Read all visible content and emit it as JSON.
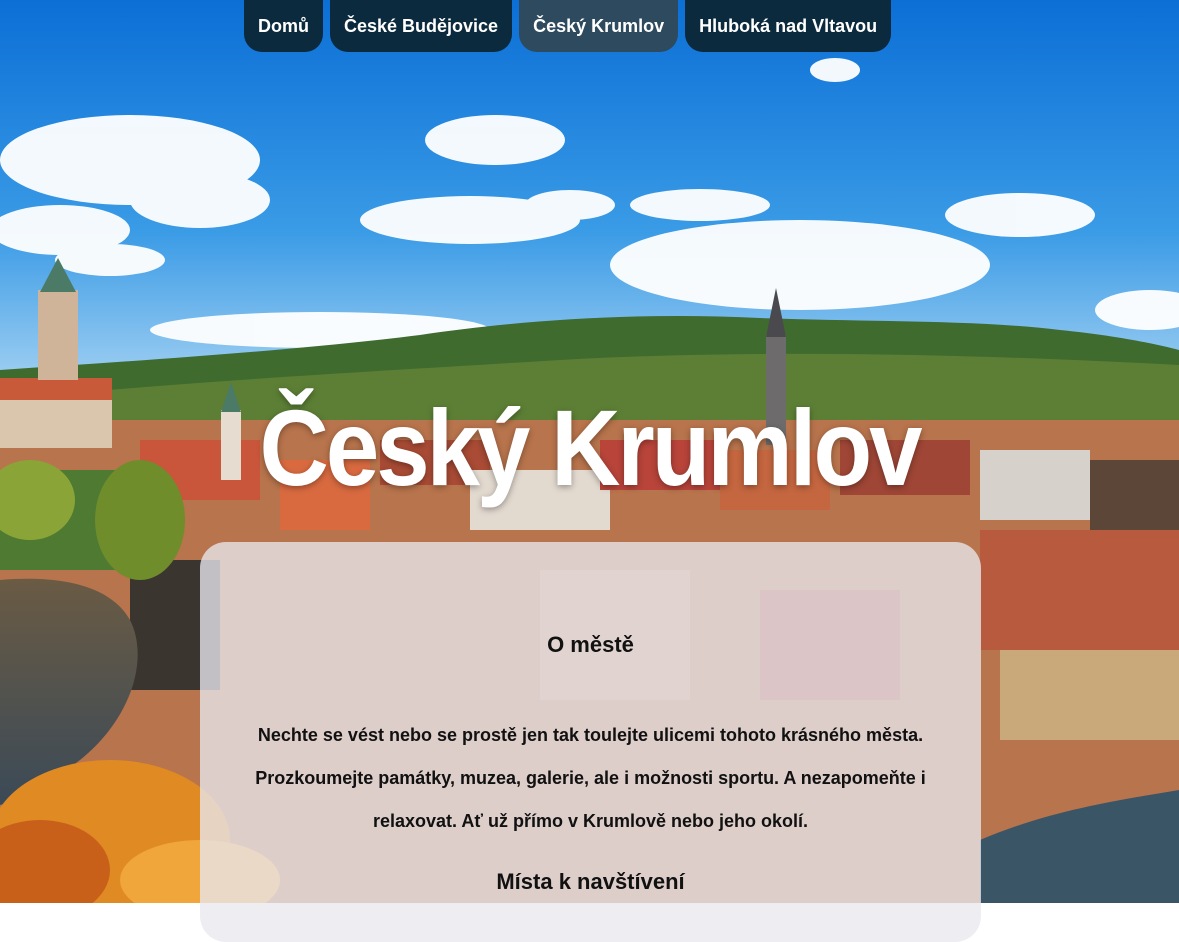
{
  "nav": {
    "items": [
      {
        "label": "Domů",
        "active": false
      },
      {
        "label": "České Budějovice",
        "active": false
      },
      {
        "label": "Český Krumlov",
        "active": true
      },
      {
        "label": "Hluboká nad Vltavou",
        "active": false
      }
    ]
  },
  "hero": {
    "title": "Český Krumlov"
  },
  "about": {
    "heading": "O městě",
    "text": "Nechte se vést nebo se prostě jen tak toulejte ulicemi tohoto krásného města. Prozkoumejte památky, muzea, galerie, ale i možnosti sportu. A nezapomeňte i relaxovat. Ať už přímo v Krumlově nebo jeho okolí.",
    "next_heading": "Místa k navštívení"
  },
  "colors": {
    "nav_bg": "#0c2a3d",
    "nav_active_bg": "#2e4a5e",
    "panel_bg": "rgba(232,232,238,0.78)"
  }
}
